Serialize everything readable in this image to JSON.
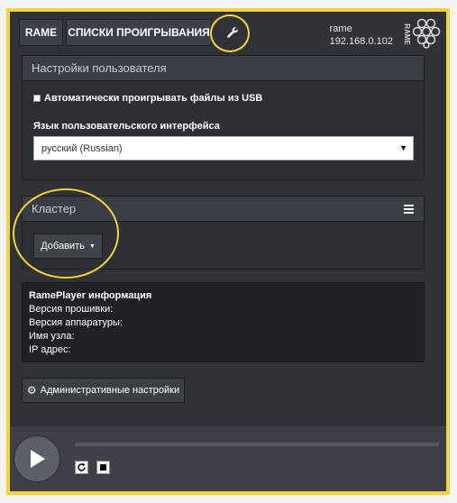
{
  "tabs": {
    "rame": "RAME",
    "playlists": "СПИСКИ ПРОИГРЫВАНИЯ"
  },
  "device": {
    "name": "rame",
    "ip": "192.168.0.102",
    "logo_text": "RAME"
  },
  "user_settings": {
    "title": "Настройки пользователя",
    "autoplay_label": "Автоматически проигрывать файлы из USB",
    "language_label": "Язык пользовательского интерфейса",
    "language_value": "русский (Russian)"
  },
  "cluster": {
    "title": "Кластер",
    "add_label": "Добавить"
  },
  "info": {
    "title": "RamePlayer информация",
    "firmware": "Версия прошивки:",
    "hardware": "Версия аппаратуры:",
    "hostname": "Имя узла:",
    "ip": "IP адрес:"
  },
  "admin_label": "Административные настройки",
  "colors": {
    "highlight": "#f6d23b",
    "background": "#2f3338"
  }
}
